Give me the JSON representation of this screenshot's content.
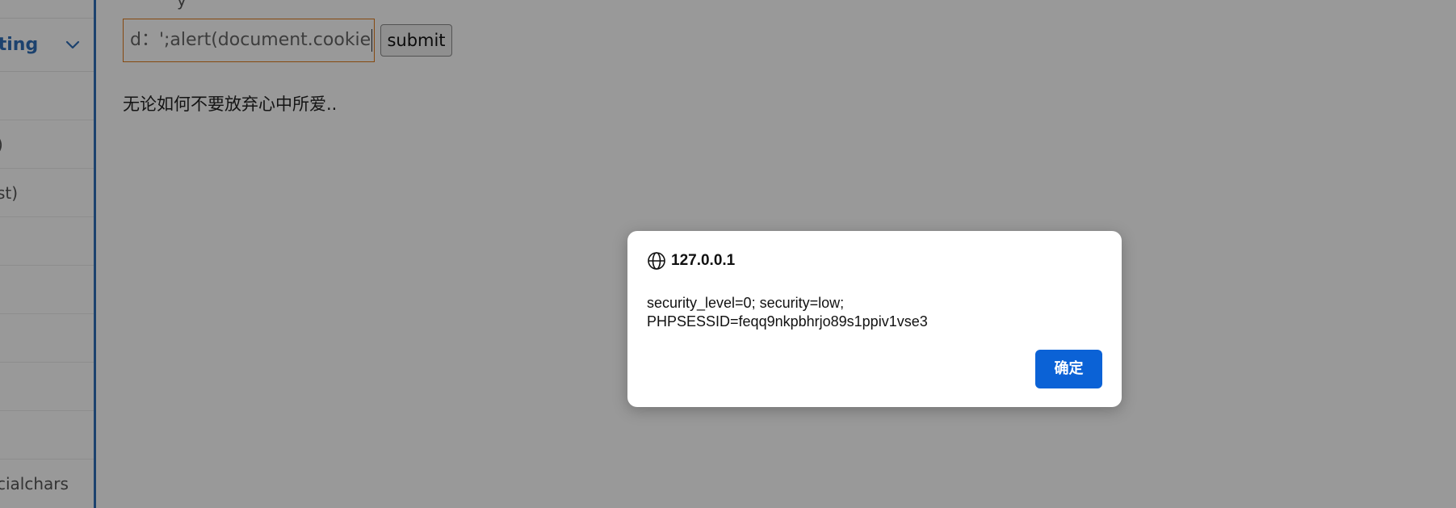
{
  "sidebar": {
    "section_title": "pting",
    "items": [
      {
        "label": ""
      },
      {
        "label": ")"
      },
      {
        "label": "st)"
      },
      {
        "label": ""
      },
      {
        "label": ""
      },
      {
        "label": ""
      },
      {
        "label": ""
      },
      {
        "label": ""
      },
      {
        "label": "cialchars"
      }
    ]
  },
  "main": {
    "clipped_text": "y",
    "input_value": "d：';alert(document.cookie",
    "submit_label": "submit",
    "output_text": "无论如何不要放弃心中所爱.."
  },
  "dialog": {
    "origin": "127.0.0.1",
    "message_line1": "security_level=0; security=low;",
    "message_line2": "PHPSESSID=feqq9nkpbhrjo89s1ppiv1vse3",
    "ok_label": "确定"
  },
  "colors": {
    "accent": "#2f6fb8",
    "ok_button": "#0b62d6",
    "input_border": "#e07a1c"
  }
}
